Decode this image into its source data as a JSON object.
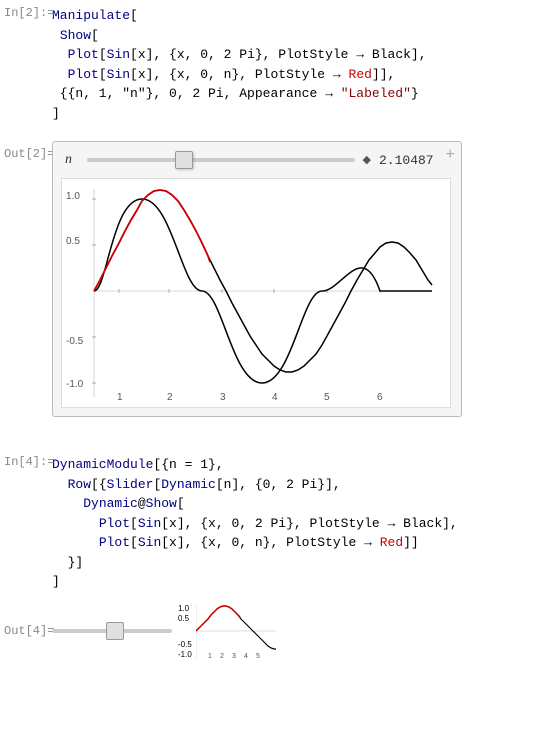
{
  "in2": {
    "label": "In[2]:=",
    "code_lines": [
      "Manipulate[",
      " Show[",
      "  Plot[Sin[x], {x, 0, 2 Pi}, PlotStyle → Black],",
      "  Plot[Sin[x], {x, 0, n}, PlotStyle → Red]],",
      " {{n, 1, \"n\"}, 0, 2 Pi, Appearance → \"Labeled\"}",
      "]"
    ]
  },
  "out2": {
    "label": "Out[2]=",
    "slider_var": "n",
    "slider_value": "2.10487",
    "y_labels": [
      "1.0",
      "0.5",
      "",
      "-0.5",
      "-1.0"
    ],
    "x_labels": [
      "1",
      "2",
      "3",
      "4",
      "5",
      "6"
    ],
    "corner_icon": "+"
  },
  "in4": {
    "label": "In[4]:=",
    "code_lines": [
      "DynamicModule[{n = 1},",
      " Row[{Slider[Dynamic[n], {0, 2 Pi}],",
      "   Dynamic@Show[",
      "     Plot[Sin[x], {x, 0, 2 Pi}, PlotStyle → Black],",
      "     Plot[Sin[x], {x, 0, n}, PlotStyle → Red]]",
      " }]",
      "]"
    ]
  },
  "out4": {
    "label": "Out[4]=",
    "mini_y_labels": [
      "1.0",
      "0.5",
      "-0.5",
      "-1.0"
    ],
    "mini_x_labels": [
      "1",
      "2",
      "3",
      "4",
      "5"
    ]
  },
  "appearance_text": "Appearance"
}
